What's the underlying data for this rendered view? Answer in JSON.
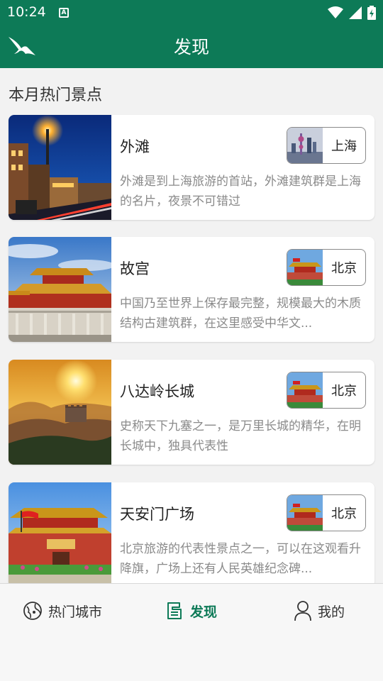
{
  "status_bar": {
    "time": "10:24",
    "notification_icon": "A"
  },
  "app_bar": {
    "title": "发现",
    "logo_icon": "bird-logo-icon"
  },
  "section_title": "本月热门景点",
  "spots": [
    {
      "name": "外滩",
      "description": "外滩是到上海旅游的首站，外滩建筑群是上海的名片，夜景不可错过",
      "city": "上海"
    },
    {
      "name": "故宫",
      "description": "中国乃至世界上保存最完整，规模最大的木质结构古建筑群，在这里感受中华文...",
      "city": "北京"
    },
    {
      "name": "八达岭长城",
      "description": "史称天下九塞之一，是万里长城的精华，在明长城中，独具代表性",
      "city": "北京"
    },
    {
      "name": "天安门广场",
      "description": "北京旅游的代表性景点之一，可以在这观看升降旗，广场上还有人民英雄纪念碑...",
      "city": "北京"
    }
  ],
  "bottom_nav": {
    "items": [
      {
        "label": "热门城市",
        "icon": "globe-icon"
      },
      {
        "label": "发现",
        "icon": "document-icon"
      },
      {
        "label": "我的",
        "icon": "person-icon"
      }
    ],
    "active": "发现"
  },
  "colors": {
    "primary": "#0d7a57",
    "background": "#f2f2f2",
    "muted_text": "#8a8a8a"
  }
}
